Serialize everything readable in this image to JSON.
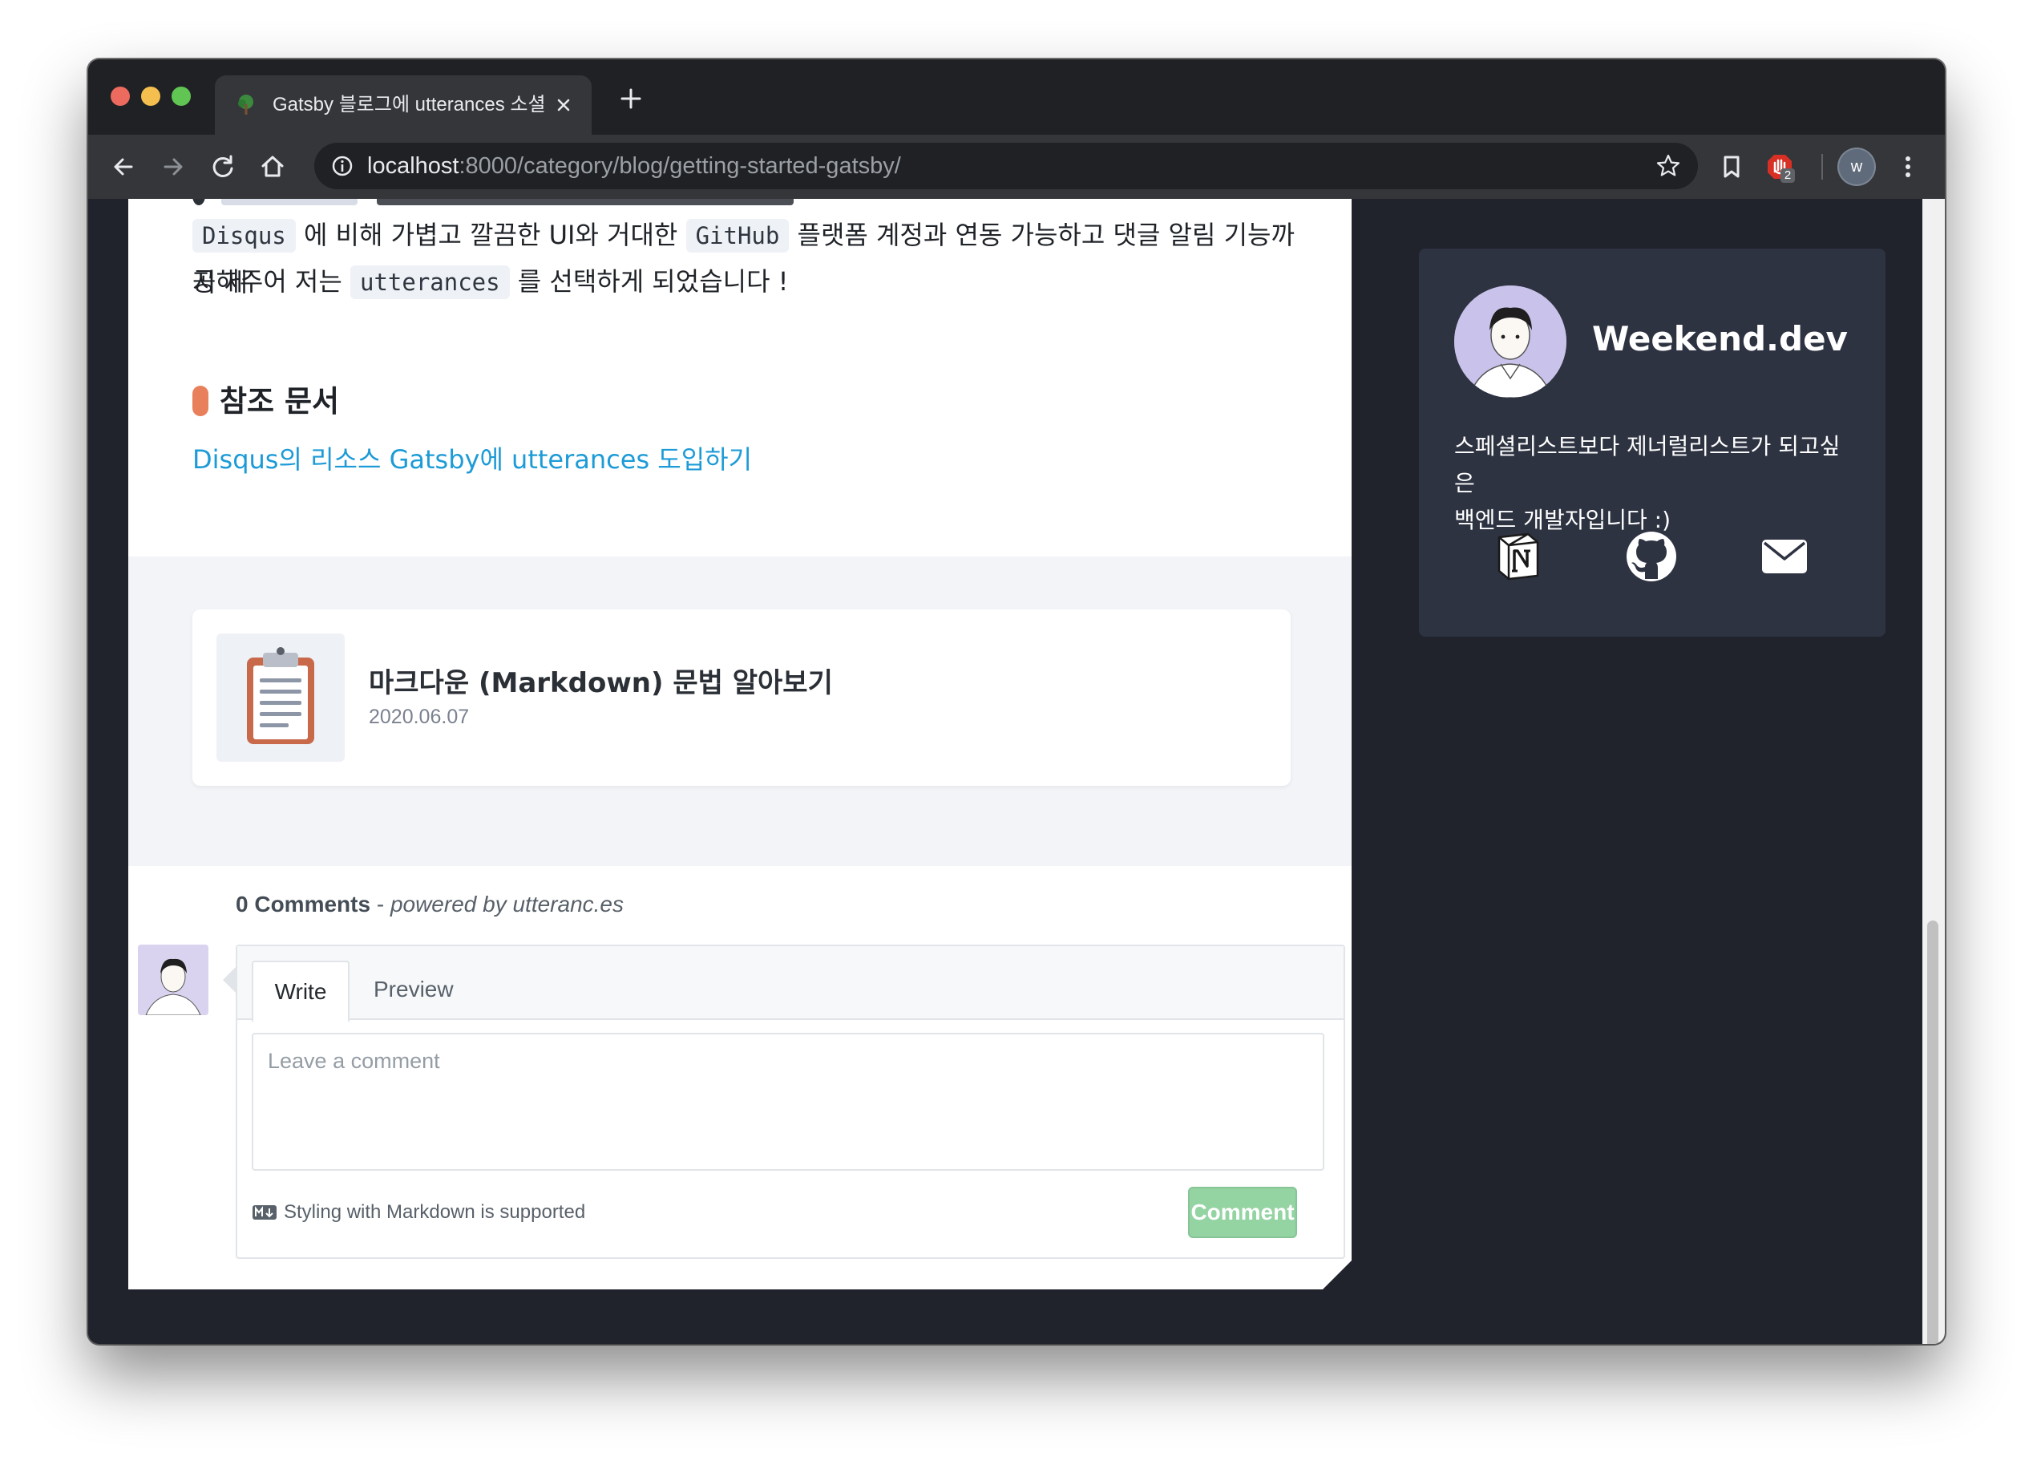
{
  "browser": {
    "tab_title": "Gatsby 블로그에 utterances 소셜",
    "url_host": "localhost",
    "url_path": ":8000/category/blog/getting-started-gatsby/",
    "extension_badge": "2",
    "profile_initial": "w"
  },
  "article": {
    "para_1": "에 비해 가볍고 깔끔한 UI와 거대한",
    "para_2": "플랫폼 계정과 연동 가능하고 댓글 알림 기능까지 제",
    "para_3": "공해주어 저는",
    "para_4": "를 선택하게 되었습니다 !",
    "code_disqus": "Disqus",
    "code_github": "GitHub",
    "code_utterances": "utterances",
    "reference_heading": "참조 문서",
    "reference_link": "Disqus의 리소스 Gatsby에 utterances 도입하기"
  },
  "related_post": {
    "title": "마크다운 (Markdown) 문법 알아보기",
    "date": "2020.06.07"
  },
  "comments": {
    "count": "0 Comments",
    "powered_prefix": " - ",
    "powered_by": "powered by utteranc.es",
    "tab_write": "Write",
    "tab_preview": "Preview",
    "placeholder": "Leave a comment",
    "markdown_note": "Styling with Markdown is supported",
    "submit_label": "Comment"
  },
  "profile": {
    "name": "Weekend.dev",
    "bio_line_1": "스페셜리스트보다 제너럴리스트가 되고싶은",
    "bio_line_2": "백엔드 개발자입니다 :)"
  },
  "colors": {
    "accent_link": "#1d9bd7",
    "heading_marker": "#e8805c",
    "comment_button": "#94d3a2",
    "sidebar_card": "#2e3342",
    "page_background": "#20232c"
  }
}
